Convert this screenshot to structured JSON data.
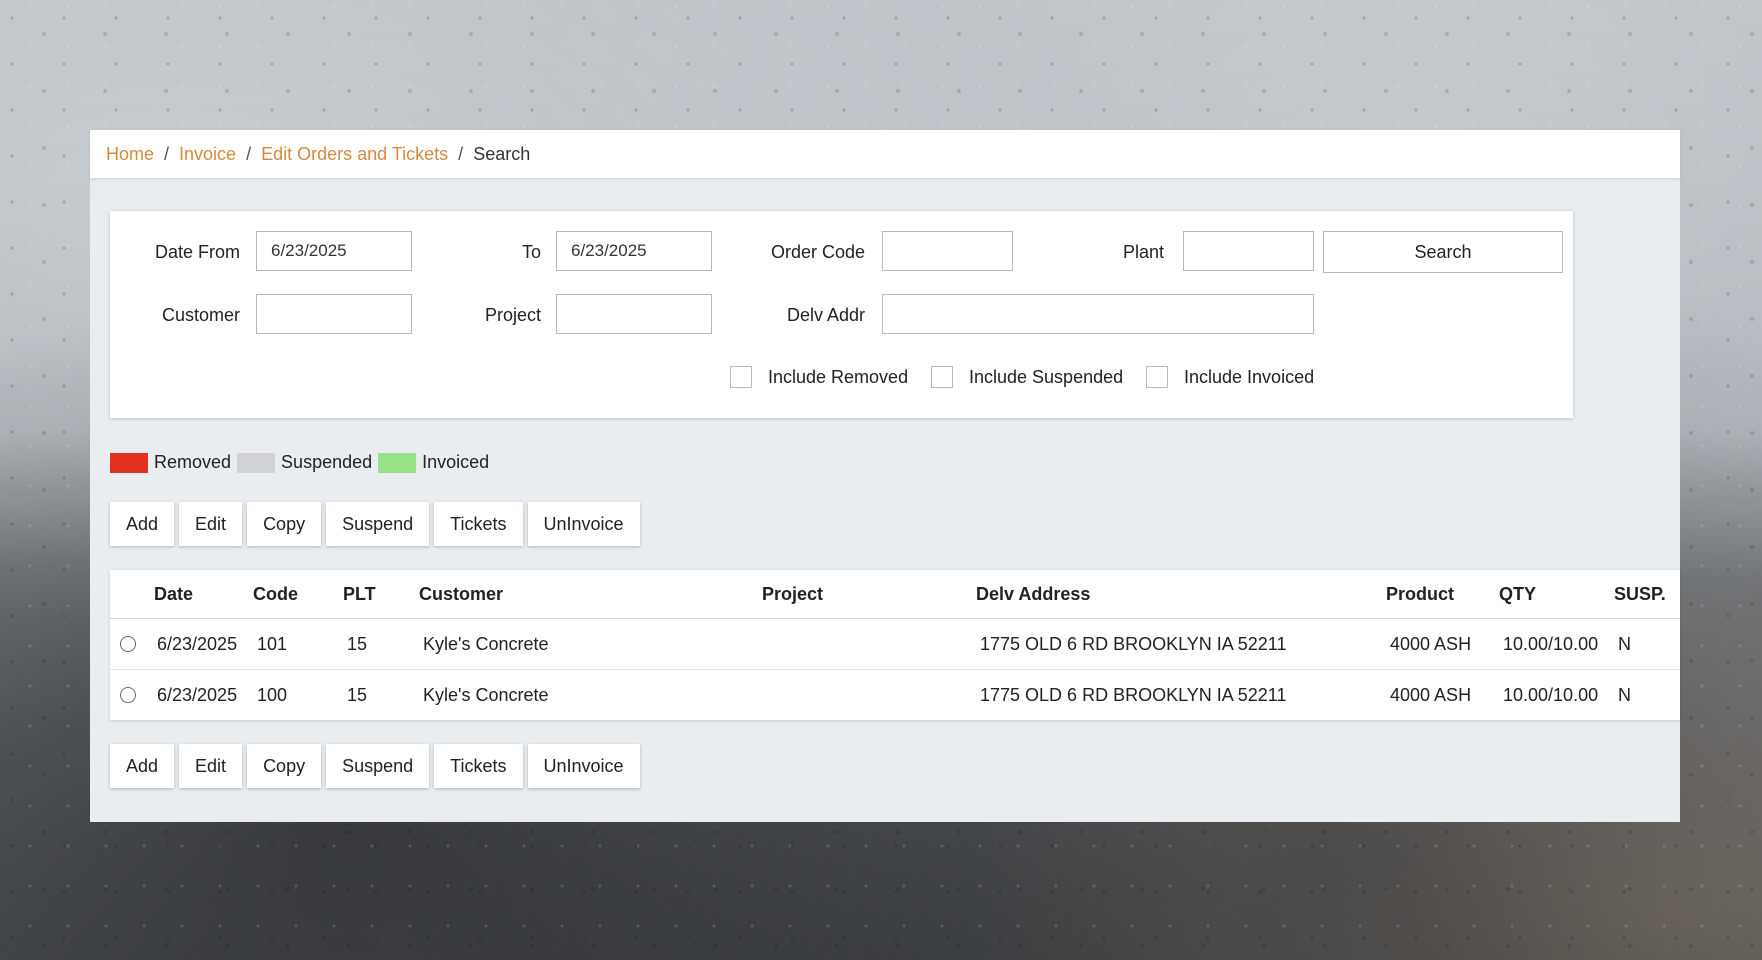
{
  "breadcrumb": {
    "home": "Home",
    "invoice": "Invoice",
    "edit": "Edit Orders and Tickets",
    "current": "Search",
    "separator": "/"
  },
  "filters": {
    "date_from_label": "Date From",
    "date_from_value": "6/23/2025",
    "to_label": "To",
    "to_value": "6/23/2025",
    "order_code_label": "Order Code",
    "order_code_value": "",
    "plant_label": "Plant",
    "plant_value": "",
    "search_label": "Search",
    "customer_label": "Customer",
    "customer_value": "",
    "project_label": "Project",
    "project_value": "",
    "delv_addr_label": "Delv Addr",
    "delv_addr_value": "",
    "include_removed": "Include Removed",
    "include_suspended": "Include Suspended",
    "include_invoiced": "Include Invoiced"
  },
  "legend": {
    "removed": "Removed",
    "suspended": "Suspended",
    "invoiced": "Invoiced",
    "colors": {
      "removed": "#e2321f",
      "suspended": "#cfd1d3",
      "invoiced": "#98e28a"
    }
  },
  "actions": {
    "add": "Add",
    "edit": "Edit",
    "copy": "Copy",
    "suspend": "Suspend",
    "tickets": "Tickets",
    "uninvoice": "UnInvoice"
  },
  "table": {
    "headers": {
      "date": "Date",
      "code": "Code",
      "plt": "PLT",
      "customer": "Customer",
      "project": "Project",
      "delv_address": "Delv Address",
      "product": "Product",
      "qty": "QTY",
      "susp": "SUSP."
    },
    "rows": [
      {
        "date": "6/23/2025",
        "code": "101",
        "plt": "15",
        "customer": "Kyle's Concrete",
        "project": "",
        "delv_address": "1775 OLD 6 RD BROOKLYN IA 52211",
        "product": "4000 ASH",
        "qty": "10.00/10.00",
        "susp": "N"
      },
      {
        "date": "6/23/2025",
        "code": "100",
        "plt": "15",
        "customer": "Kyle's Concrete",
        "project": "",
        "delv_address": "1775 OLD 6 RD BROOKLYN IA 52211",
        "product": "4000 ASH",
        "qty": "10.00/10.00",
        "susp": "N"
      }
    ]
  }
}
